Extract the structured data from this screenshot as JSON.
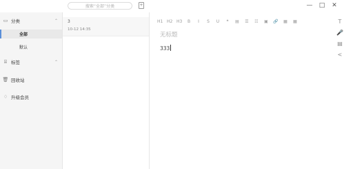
{
  "search": {
    "placeholder": "搜索“全部”分类"
  },
  "icons": {
    "new_note": "new-note-icon",
    "minimize": "minimize-icon",
    "maximize": "maximize-icon",
    "close": "close-icon"
  },
  "sidebar": {
    "category_label": "分类",
    "all_label": "全部",
    "default_label": "默认",
    "tags_label": "标签",
    "trash_label": "回收站",
    "upgrade_label": "升级会员"
  },
  "note": {
    "title": "3",
    "date": "10-12 14:35"
  },
  "toolbar": {
    "items": [
      "H1",
      "H2",
      "H3",
      "B",
      "I",
      "S",
      "U",
      "❝",
      "▤",
      "☰",
      "☷",
      "▣",
      "🔗",
      "▦",
      "▦"
    ]
  },
  "editor": {
    "title_placeholder": "无标题",
    "body": "333"
  },
  "right_tools": [
    "T",
    "🎤",
    "▤",
    "<"
  ],
  "colors": {
    "accent": "#5a8fd8",
    "sidebar_bg": "#f5f5f5"
  }
}
